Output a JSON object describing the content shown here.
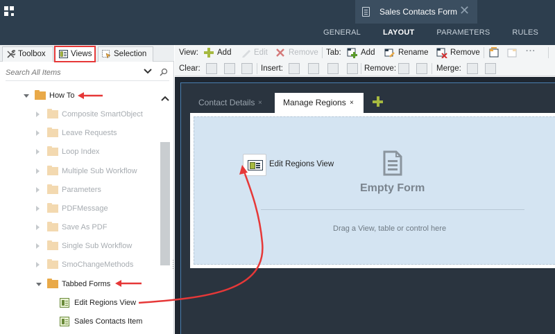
{
  "header": {
    "document_tab": {
      "title": "Sales Contacts Form",
      "icon": "document-icon"
    },
    "tabs": [
      {
        "label": "GENERAL",
        "active": false
      },
      {
        "label": "LAYOUT",
        "active": true
      },
      {
        "label": "PARAMETERS",
        "active": false
      },
      {
        "label": "RULES",
        "active": false
      }
    ]
  },
  "left_panel": {
    "tabs": [
      {
        "label": "Toolbox",
        "icon": "wrench-icon"
      },
      {
        "label": "Views",
        "icon": "view-icon",
        "active": true
      },
      {
        "label": "Selection",
        "icon": "selection-icon"
      }
    ],
    "search_placeholder": "Search All Items",
    "tree": {
      "how_to": "How To",
      "children": [
        "Composite SmartObject",
        "Leave Requests",
        "Loop Index",
        "Multiple Sub Workflow",
        "Parameters",
        "PDFMessage",
        "Save As PDF",
        "Single Sub Workflow",
        "SmoChangeMethods"
      ],
      "tabbed_forms": "Tabbed Forms",
      "views": [
        "Edit Regions View",
        "Sales Contacts Item"
      ]
    }
  },
  "toolbar": {
    "view_label": "View:",
    "view_add": "Add",
    "view_edit": "Edit",
    "view_remove": "Remove",
    "tab_label": "Tab:",
    "tab_add": "Add",
    "tab_rename": "Rename",
    "tab_remove": "Remove",
    "clear_label": "Clear:",
    "insert_label": "Insert:",
    "remove_label": "Remove:",
    "merge_label": "Merge:"
  },
  "canvas": {
    "tabs": [
      {
        "label": "Contact Details",
        "active": false
      },
      {
        "label": "Manage Regions",
        "active": true
      }
    ],
    "close_glyph": "×",
    "placed_view": "Edit Regions View",
    "empty_title": "Empty Form",
    "drop_hint": "Drag a View, table or control here"
  },
  "colors": {
    "header_bg": "#2d3e4e",
    "accent_green": "#a6b940",
    "annotation_red": "#e63838",
    "drop_zone": "#d4e4f2"
  }
}
